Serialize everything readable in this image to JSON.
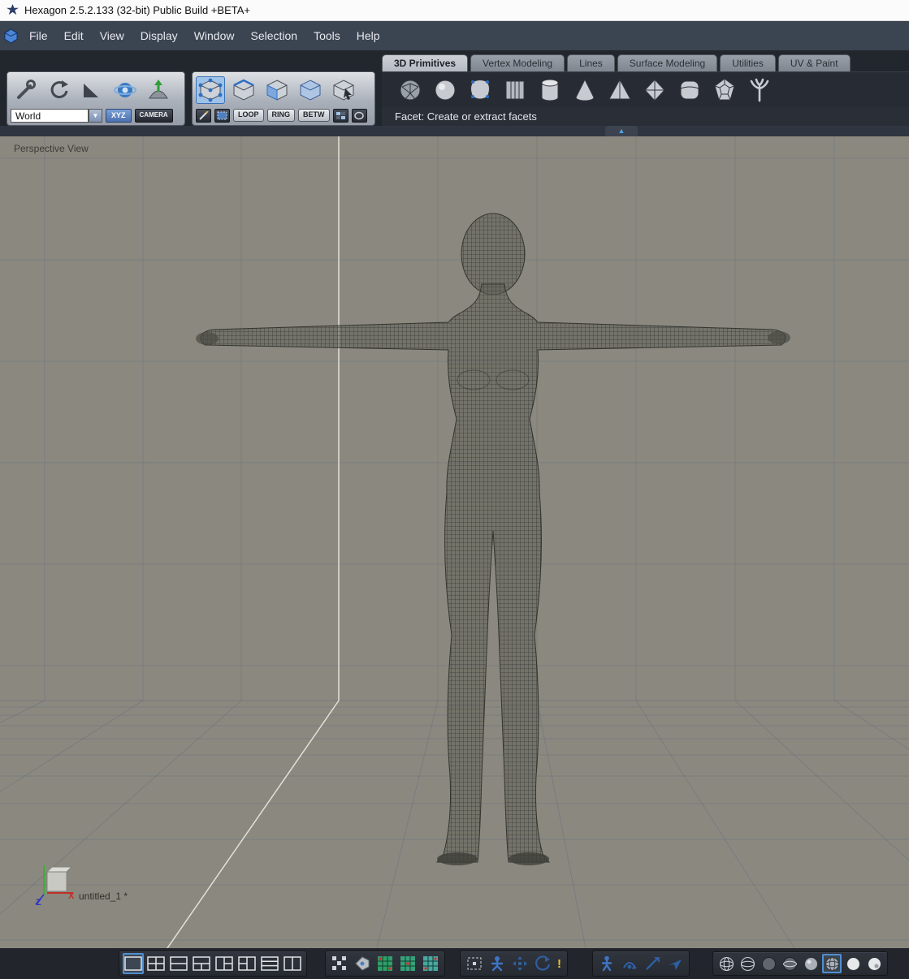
{
  "titlebar": {
    "title": "Hexagon 2.5.2.133 (32-bit)  Public Build +BETA+"
  },
  "menubar": {
    "items": [
      "File",
      "Edit",
      "View",
      "Display",
      "Window",
      "Selection",
      "Tools",
      "Help"
    ]
  },
  "manipulator_panel": {
    "dropdown_value": "World",
    "xyz": "XYZ",
    "camera": "CAMERA",
    "tools": [
      "translate-tool",
      "rotate-tool",
      "scale-tool",
      "universal-manipulator",
      "soft-selection"
    ]
  },
  "selection_panel": {
    "loop": "LOOP",
    "ring": "RING",
    "betw": "BETW",
    "modes": [
      "select-points",
      "select-edges",
      "select-faces",
      "select-object",
      "select-auto"
    ]
  },
  "tabs": [
    {
      "label": "3D Primitives",
      "active": true
    },
    {
      "label": "Vertex Modeling",
      "active": false
    },
    {
      "label": "Lines",
      "active": false
    },
    {
      "label": "Surface Modeling",
      "active": false
    },
    {
      "label": "Utilities",
      "active": false
    },
    {
      "label": "UV & Paint",
      "active": false
    }
  ],
  "primitives_bar": {
    "status": "Facet: Create or extract facets",
    "icons": [
      "facet",
      "sphere",
      "geosphere",
      "grid",
      "cylinder",
      "cone",
      "pyramid",
      "gem",
      "chamfer-box",
      "dodecahedron",
      "tree"
    ]
  },
  "viewport": {
    "label": "Perspective View",
    "document_name": "untitled_1 *",
    "axis_x": "X",
    "axis_z": "Z"
  },
  "bottom_bar": {
    "layout_buttons": [
      "layout-single",
      "layout-quad",
      "layout-two-rows",
      "layout-one-top-two-bottom",
      "layout-left-one-right-two",
      "layout-left-two-right-one",
      "layout-three-rows",
      "layout-two-columns"
    ],
    "layout_selected_index": 0,
    "display_grids": [
      "pixel-grid",
      "material-tag",
      "uv-grid-a",
      "uv-grid-b",
      "uv-grid-c"
    ],
    "camera_tools": [
      "marquee-select",
      "seat-view",
      "pan-view",
      "orbit-view"
    ],
    "navigation_tools": [
      "walk-mode",
      "orbit-camera",
      "pan-camera",
      "fly-camera"
    ],
    "shading_modes": [
      "wireframe",
      "hidden-line",
      "flat",
      "flat-wire",
      "smooth",
      "smooth-wire",
      "textured",
      "textured-lit"
    ],
    "shading_selected_index": 5
  },
  "colors": {
    "accent_blue": "#4f8fd0",
    "menubar_bg": "#3b4451",
    "toolbar_bg": "#22262d",
    "viewport_bg": "#8b897f",
    "grid_line": "#6d727e",
    "axis_highlight_line": "#eceae3",
    "axis_x_red": "#c03028",
    "axis_y_green": "#2db82d",
    "axis_z_blue": "#2a35c0"
  }
}
